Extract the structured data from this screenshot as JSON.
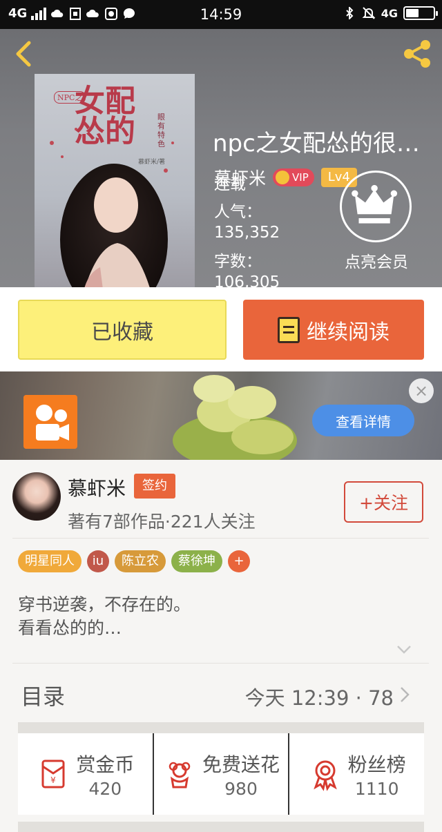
{
  "status_bar": {
    "network": "4G",
    "time": "14:59",
    "network_right": "4G"
  },
  "book": {
    "cover_title": "女配怂的",
    "cover_series": "NPC之",
    "cover_tag": "眼有特色",
    "cover_author": "慕虾米/著",
    "title": "npc之女配怂的很…",
    "author": "慕虾米",
    "vip_label": "VIP",
    "level_label": "Lv4",
    "status": "连载",
    "popularity_label": "人气：",
    "popularity_value": "135,352",
    "wordcount_label": "字数：",
    "wordcount_value": "106,305",
    "vip_cta_label": "点亮会员"
  },
  "actions": {
    "collected_label": "已收藏",
    "continue_label": "继续阅读"
  },
  "ad": {
    "details_label": "查看详情",
    "close_label": "×"
  },
  "author_card": {
    "name": "慕虾米",
    "signed_badge": "签约",
    "stats": "著有7部作品·221人关注",
    "follow_label": "+关注"
  },
  "tags": [
    {
      "label": "明星同人",
      "color": "#f0a93a"
    },
    {
      "label": "iu",
      "color": "#c1584a"
    },
    {
      "label": "陈立农",
      "color": "#d79a3a"
    },
    {
      "label": "蔡徐坤",
      "color": "#8cb14a"
    },
    {
      "label": "+",
      "color": "#e9653b"
    }
  ],
  "synopsis": {
    "line1": "穿书逆袭，不存在的。",
    "line2": "看看怂的的…"
  },
  "toc": {
    "label": "目录",
    "update": "今天 12:39 · 78"
  },
  "rewards": [
    {
      "label": "赏金币",
      "value": "420",
      "icon": "red-envelope-icon"
    },
    {
      "label": "免费送花",
      "value": "980",
      "icon": "flower-icon"
    },
    {
      "label": "粉丝榜",
      "value": "1110",
      "icon": "medal-icon"
    }
  ],
  "colors": {
    "accent": "#e9653b",
    "collected_bg": "#fdf07a",
    "follow_border": "#d2493a",
    "icon_red": "#d63a2f"
  }
}
